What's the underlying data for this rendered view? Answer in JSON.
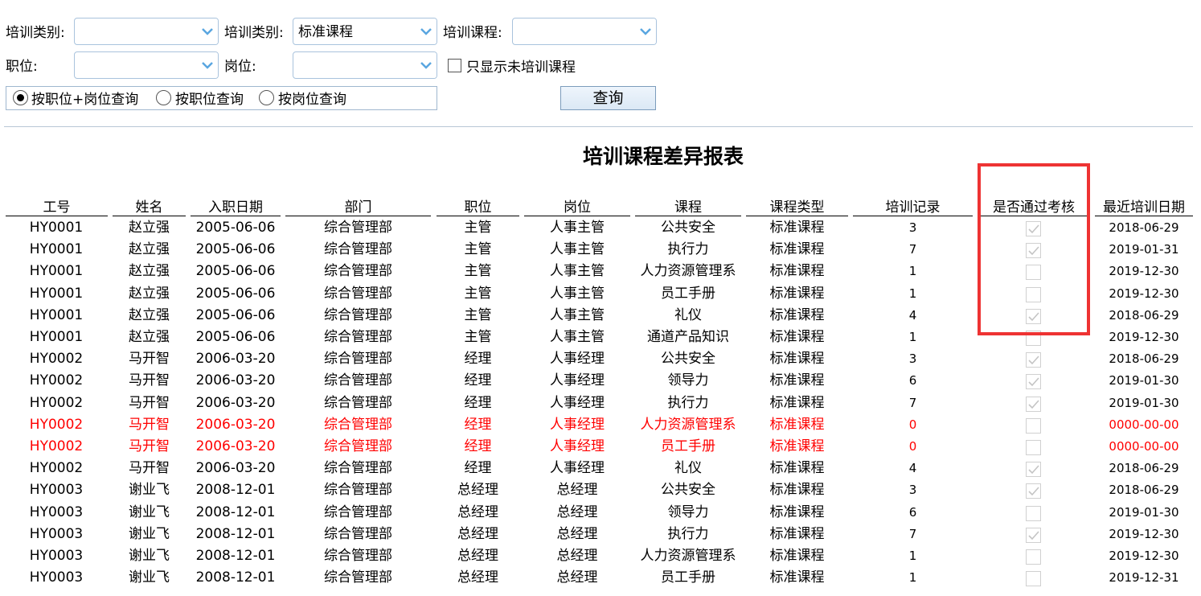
{
  "filters": {
    "training_category_1_label": "培训类别:",
    "training_category_1_value": "",
    "training_category_2_label": "培训类别:",
    "training_category_2_value": "标准课程",
    "training_course_label": "培训课程:",
    "training_course_value": "",
    "position_label": "职位:",
    "position_value": "",
    "post_label": "岗位:",
    "post_value": "",
    "only_untrained_label": "只显示未培训课程",
    "only_untrained_checked": false,
    "query_modes": [
      {
        "label": "按职位+岗位查询",
        "selected": true
      },
      {
        "label": "按职位查询",
        "selected": false
      },
      {
        "label": "按岗位查询",
        "selected": false
      }
    ],
    "query_button": "查询"
  },
  "report": {
    "title": "培训课程差异报表",
    "columns": [
      "工号",
      "姓名",
      "入职日期",
      "部门",
      "职位",
      "岗位",
      "课程",
      "课程类型",
      "培训记录",
      "是否通过考核",
      "最近培训日期"
    ],
    "rows": [
      {
        "id": "HY0001",
        "name": "赵立强",
        "hire": "2005-06-06",
        "dept": "综合管理部",
        "pos": "主管",
        "post": "人事主管",
        "course": "公共安全",
        "type": "标准课程",
        "records": "3",
        "passed": true,
        "last": "2018-06-29",
        "red": false
      },
      {
        "id": "HY0001",
        "name": "赵立强",
        "hire": "2005-06-06",
        "dept": "综合管理部",
        "pos": "主管",
        "post": "人事主管",
        "course": "执行力",
        "type": "标准课程",
        "records": "7",
        "passed": true,
        "last": "2019-01-31",
        "red": false
      },
      {
        "id": "HY0001",
        "name": "赵立强",
        "hire": "2005-06-06",
        "dept": "综合管理部",
        "pos": "主管",
        "post": "人事主管",
        "course": "人力资源管理系",
        "type": "标准课程",
        "records": "1",
        "passed": false,
        "last": "2019-12-30",
        "red": false
      },
      {
        "id": "HY0001",
        "name": "赵立强",
        "hire": "2005-06-06",
        "dept": "综合管理部",
        "pos": "主管",
        "post": "人事主管",
        "course": "员工手册",
        "type": "标准课程",
        "records": "1",
        "passed": false,
        "last": "2019-12-30",
        "red": false
      },
      {
        "id": "HY0001",
        "name": "赵立强",
        "hire": "2005-06-06",
        "dept": "综合管理部",
        "pos": "主管",
        "post": "人事主管",
        "course": "礼仪",
        "type": "标准课程",
        "records": "4",
        "passed": true,
        "last": "2018-06-29",
        "red": false
      },
      {
        "id": "HY0001",
        "name": "赵立强",
        "hire": "2005-06-06",
        "dept": "综合管理部",
        "pos": "主管",
        "post": "人事主管",
        "course": "通道产品知识",
        "type": "标准课程",
        "records": "1",
        "passed": false,
        "last": "2019-12-30",
        "red": false
      },
      {
        "id": "HY0002",
        "name": "马开智",
        "hire": "2006-03-20",
        "dept": "综合管理部",
        "pos": "经理",
        "post": "人事经理",
        "course": "公共安全",
        "type": "标准课程",
        "records": "3",
        "passed": true,
        "last": "2018-06-29",
        "red": false
      },
      {
        "id": "HY0002",
        "name": "马开智",
        "hire": "2006-03-20",
        "dept": "综合管理部",
        "pos": "经理",
        "post": "人事经理",
        "course": "领导力",
        "type": "标准课程",
        "records": "6",
        "passed": true,
        "last": "2019-01-30",
        "red": false
      },
      {
        "id": "HY0002",
        "name": "马开智",
        "hire": "2006-03-20",
        "dept": "综合管理部",
        "pos": "经理",
        "post": "人事经理",
        "course": "执行力",
        "type": "标准课程",
        "records": "7",
        "passed": true,
        "last": "2019-01-30",
        "red": false
      },
      {
        "id": "HY0002",
        "name": "马开智",
        "hire": "2006-03-20",
        "dept": "综合管理部",
        "pos": "经理",
        "post": "人事经理",
        "course": "人力资源管理系",
        "type": "标准课程",
        "records": "0",
        "passed": false,
        "last": "0000-00-00",
        "red": true
      },
      {
        "id": "HY0002",
        "name": "马开智",
        "hire": "2006-03-20",
        "dept": "综合管理部",
        "pos": "经理",
        "post": "人事经理",
        "course": "员工手册",
        "type": "标准课程",
        "records": "0",
        "passed": false,
        "last": "0000-00-00",
        "red": true
      },
      {
        "id": "HY0002",
        "name": "马开智",
        "hire": "2006-03-20",
        "dept": "综合管理部",
        "pos": "经理",
        "post": "人事经理",
        "course": "礼仪",
        "type": "标准课程",
        "records": "4",
        "passed": true,
        "last": "2018-06-29",
        "red": false
      },
      {
        "id": "HY0003",
        "name": "谢业飞",
        "hire": "2008-12-01",
        "dept": "综合管理部",
        "pos": "总经理",
        "post": "总经理",
        "course": "公共安全",
        "type": "标准课程",
        "records": "3",
        "passed": true,
        "last": "2018-06-29",
        "red": false
      },
      {
        "id": "HY0003",
        "name": "谢业飞",
        "hire": "2008-12-01",
        "dept": "综合管理部",
        "pos": "总经理",
        "post": "总经理",
        "course": "领导力",
        "type": "标准课程",
        "records": "6",
        "passed": false,
        "last": "2019-01-30",
        "red": false
      },
      {
        "id": "HY0003",
        "name": "谢业飞",
        "hire": "2008-12-01",
        "dept": "综合管理部",
        "pos": "总经理",
        "post": "总经理",
        "course": "执行力",
        "type": "标准课程",
        "records": "7",
        "passed": true,
        "last": "2019-12-30",
        "red": false
      },
      {
        "id": "HY0003",
        "name": "谢业飞",
        "hire": "2008-12-01",
        "dept": "综合管理部",
        "pos": "总经理",
        "post": "总经理",
        "course": "人力资源管理系",
        "type": "标准课程",
        "records": "1",
        "passed": false,
        "last": "2019-12-30",
        "red": false
      },
      {
        "id": "HY0003",
        "name": "谢业飞",
        "hire": "2008-12-01",
        "dept": "综合管理部",
        "pos": "总经理",
        "post": "总经理",
        "course": "员工手册",
        "type": "标准课程",
        "records": "1",
        "passed": false,
        "last": "2019-12-31",
        "red": false
      }
    ]
  },
  "colors": {
    "highlight_border": "#ee3333",
    "unmatched_row_text": "#ff0000",
    "combo_border": "#a9c3dd"
  }
}
